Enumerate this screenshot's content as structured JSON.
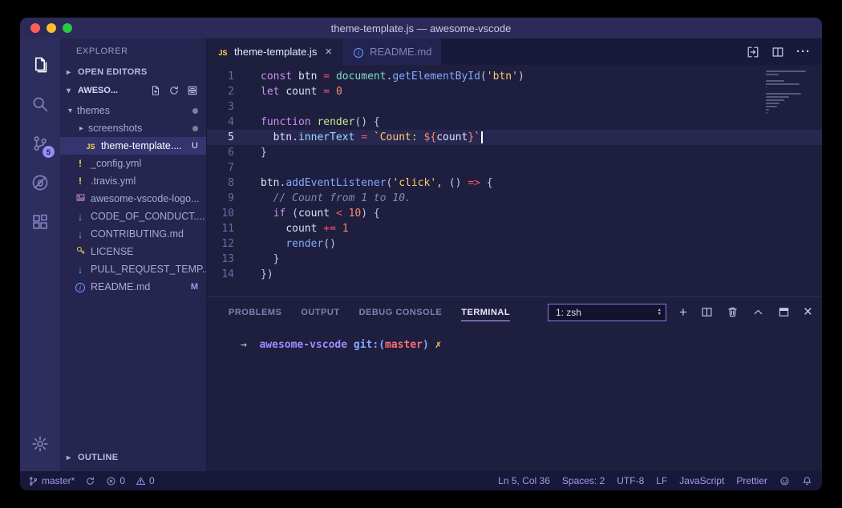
{
  "window": {
    "title": "theme-template.js — awesome-vscode"
  },
  "colors": {
    "editor_background": "#1E1E3F",
    "accent_purple": "#A599E9",
    "selection_row": "#34346E",
    "scm_badge": "#9A8BF5",
    "keyword": "#C792EA",
    "string": "#FFCB6B",
    "terminal_branch_red": "#FF6E6E"
  },
  "activity_bar": {
    "items": [
      {
        "name": "explorer",
        "icon": "files-icon",
        "active": true
      },
      {
        "name": "search",
        "icon": "search-icon",
        "active": false
      },
      {
        "name": "source-control",
        "icon": "source-control-icon",
        "active": false,
        "badge": "5"
      },
      {
        "name": "debug",
        "icon": "debug-icon",
        "active": false
      },
      {
        "name": "extensions",
        "icon": "extensions-icon",
        "active": false
      }
    ],
    "bottom": [
      {
        "name": "settings",
        "icon": "gear-icon",
        "active": false
      }
    ]
  },
  "sidebar": {
    "header": "EXPLORER",
    "open_editors": {
      "label": "OPEN EDITORS"
    },
    "root": {
      "label": "AWESO...",
      "actions": [
        "new-file-icon",
        "refresh-icon",
        "collapse-all-icon"
      ]
    },
    "files": [
      {
        "type": "folder",
        "label": "themes",
        "indent": 1,
        "expanded": true,
        "dot": true
      },
      {
        "type": "folder",
        "label": "screenshots",
        "indent": 2,
        "expanded": false,
        "dot": true
      },
      {
        "type": "file",
        "icon": "js-file-icon",
        "label": "theme-template....",
        "indent": 2,
        "badge": "U",
        "selected": true
      },
      {
        "type": "file",
        "icon": "yaml-file-icon",
        "label": "_config.yml",
        "indent": 1
      },
      {
        "type": "file",
        "icon": "yaml-file-icon",
        "label": ".travis.yml",
        "indent": 1
      },
      {
        "type": "file",
        "icon": "image-file-icon",
        "label": "awesome-vscode-logo...",
        "indent": 1
      },
      {
        "type": "file",
        "icon": "md-file-icon",
        "label": "CODE_OF_CONDUCT....",
        "indent": 1
      },
      {
        "type": "file",
        "icon": "md-file-icon",
        "label": "CONTRIBUTING.md",
        "indent": 1
      },
      {
        "type": "file",
        "icon": "license-file-icon",
        "label": "LICENSE",
        "indent": 1
      },
      {
        "type": "file",
        "icon": "md-file-icon",
        "label": "PULL_REQUEST_TEMP...",
        "indent": 1
      },
      {
        "type": "file",
        "icon": "info-file-icon",
        "label": "README.md",
        "indent": 1,
        "badge": "M"
      }
    ],
    "outline": {
      "label": "OUTLINE"
    }
  },
  "editor": {
    "tabs": [
      {
        "label": "theme-template.js",
        "icon": "js-file-icon",
        "active": true,
        "has_close": true,
        "close_glyph": "×"
      },
      {
        "label": "README.md",
        "icon": "info-file-icon",
        "active": false,
        "has_close": false
      }
    ],
    "actions": [
      "open-changes-icon",
      "split-editor-icon",
      "more-actions-icon"
    ],
    "cursor": {
      "line": 5,
      "col": 36
    },
    "lines": [
      {
        "n": 1,
        "t": [
          [
            "kw",
            "const"
          ],
          [
            "sp",
            " "
          ],
          [
            "id",
            "btn"
          ],
          [
            "sp",
            " "
          ],
          [
            "op",
            "="
          ],
          [
            "sp",
            " "
          ],
          [
            "ob",
            "document"
          ],
          [
            "pu",
            "."
          ],
          [
            "fn",
            "getElementById"
          ],
          [
            "pu",
            "("
          ],
          [
            "str",
            "'btn'"
          ],
          [
            "pu",
            ")"
          ]
        ]
      },
      {
        "n": 2,
        "t": [
          [
            "kw",
            "let"
          ],
          [
            "sp",
            " "
          ],
          [
            "id",
            "count"
          ],
          [
            "sp",
            " "
          ],
          [
            "op",
            "="
          ],
          [
            "sp",
            " "
          ],
          [
            "num",
            "0"
          ]
        ]
      },
      {
        "n": 3,
        "t": []
      },
      {
        "n": 4,
        "t": [
          [
            "kw",
            "function"
          ],
          [
            "sp",
            " "
          ],
          [
            "fd",
            "render"
          ],
          [
            "pu",
            "()"
          ],
          [
            "sp",
            " "
          ],
          [
            "pu",
            "{"
          ]
        ]
      },
      {
        "n": 5,
        "t": [
          [
            "sp",
            "  "
          ],
          [
            "id",
            "btn"
          ],
          [
            "pu",
            "."
          ],
          [
            "pr",
            "innerText"
          ],
          [
            "sp",
            " "
          ],
          [
            "op",
            "="
          ],
          [
            "sp",
            " "
          ],
          [
            "str",
            "`Count: "
          ],
          [
            "tpl",
            "${"
          ],
          [
            "id",
            "count"
          ],
          [
            "tpl",
            "}"
          ],
          [
            "str",
            "`"
          ]
        ]
      },
      {
        "n": 6,
        "t": [
          [
            "pu",
            "}"
          ]
        ]
      },
      {
        "n": 7,
        "t": []
      },
      {
        "n": 8,
        "t": [
          [
            "id",
            "btn"
          ],
          [
            "pu",
            "."
          ],
          [
            "fn",
            "addEventListener"
          ],
          [
            "pu",
            "("
          ],
          [
            "str",
            "'click'"
          ],
          [
            "pu",
            ","
          ],
          [
            "sp",
            " "
          ],
          [
            "pu",
            "()"
          ],
          [
            "sp",
            " "
          ],
          [
            "op",
            "=>"
          ],
          [
            "sp",
            " "
          ],
          [
            "pu",
            "{"
          ]
        ]
      },
      {
        "n": 9,
        "t": [
          [
            "sp",
            "  "
          ],
          [
            "cm",
            "// Count from 1 to 10."
          ]
        ]
      },
      {
        "n": 10,
        "t": [
          [
            "sp",
            "  "
          ],
          [
            "kw",
            "if"
          ],
          [
            "sp",
            " "
          ],
          [
            "pu",
            "("
          ],
          [
            "id",
            "count"
          ],
          [
            "sp",
            " "
          ],
          [
            "op",
            "<"
          ],
          [
            "sp",
            " "
          ],
          [
            "num",
            "10"
          ],
          [
            "pu",
            ")"
          ],
          [
            "sp",
            " "
          ],
          [
            "pu",
            "{"
          ]
        ]
      },
      {
        "n": 11,
        "t": [
          [
            "sp",
            "    "
          ],
          [
            "id",
            "count"
          ],
          [
            "sp",
            " "
          ],
          [
            "op",
            "+="
          ],
          [
            "sp",
            " "
          ],
          [
            "num",
            "1"
          ]
        ]
      },
      {
        "n": 12,
        "t": [
          [
            "sp",
            "    "
          ],
          [
            "fn",
            "render"
          ],
          [
            "pu",
            "()"
          ]
        ]
      },
      {
        "n": 13,
        "t": [
          [
            "sp",
            "  "
          ],
          [
            "pu",
            "}"
          ]
        ]
      },
      {
        "n": 14,
        "t": [
          [
            "pu",
            "})"
          ]
        ]
      }
    ]
  },
  "panel": {
    "tabs": [
      {
        "label": "PROBLEMS",
        "active": false
      },
      {
        "label": "OUTPUT",
        "active": false
      },
      {
        "label": "DEBUG CONSOLE",
        "active": false
      },
      {
        "label": "TERMINAL",
        "active": true
      }
    ],
    "shell_select": {
      "value": "1: zsh"
    },
    "actions": [
      "new-terminal-icon",
      "split-terminal-icon",
      "kill-terminal-icon",
      "maximize-panel-icon",
      "toggle-panel-icon",
      "close-panel-icon"
    ],
    "terminal_prompt": [
      [
        "arrow",
        "→"
      ],
      [
        "sp",
        "  "
      ],
      [
        "dir",
        "awesome-vscode"
      ],
      [
        "sp",
        " "
      ],
      [
        "gitp",
        "git:("
      ],
      [
        "branch",
        "master"
      ],
      [
        "gitp",
        ")"
      ],
      [
        "sp",
        " "
      ],
      [
        "dirty",
        "✗"
      ]
    ]
  },
  "status_bar": {
    "left": [
      {
        "name": "git-branch",
        "icon": "git-branch-icon",
        "label": "master*"
      },
      {
        "name": "sync",
        "icon": "sync-icon",
        "label": ""
      },
      {
        "name": "errors",
        "icon": "error-icon",
        "label": "0"
      },
      {
        "name": "warnings",
        "icon": "warning-icon",
        "label": "0"
      }
    ],
    "right": [
      {
        "name": "cursor-position",
        "label": "Ln 5, Col 36"
      },
      {
        "name": "indentation",
        "label": "Spaces: 2"
      },
      {
        "name": "encoding",
        "label": "UTF-8"
      },
      {
        "name": "eol",
        "label": "LF"
      },
      {
        "name": "language",
        "label": "JavaScript"
      },
      {
        "name": "formatter",
        "label": "Prettier"
      },
      {
        "name": "feedback",
        "icon": "feedback-icon",
        "label": ""
      },
      {
        "name": "notifications",
        "icon": "bell-icon",
        "label": ""
      }
    ]
  }
}
